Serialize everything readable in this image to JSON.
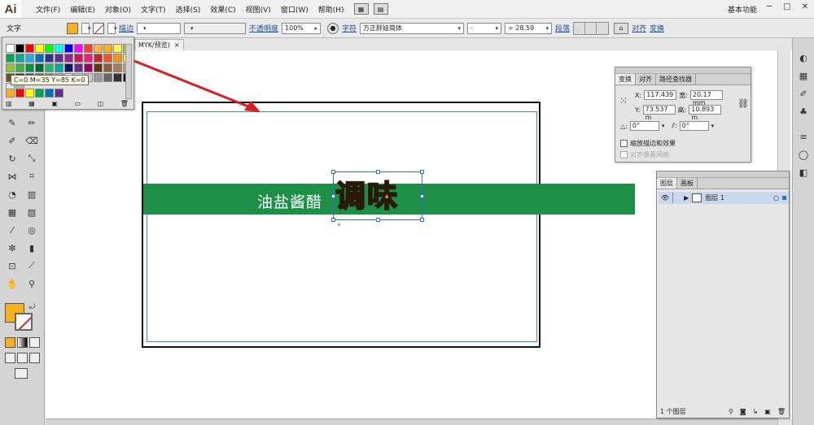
{
  "app": {
    "logo": "Ai",
    "workspace": "基本功能"
  },
  "menu": [
    "文件(F)",
    "编辑(E)",
    "对象(O)",
    "文字(T)",
    "选择(S)",
    "效果(C)",
    "视图(V)",
    "窗口(W)",
    "帮助(H)"
  ],
  "control_bar": {
    "selection_type": "文字",
    "stroke_label": "描边",
    "opacity_label": "不透明度",
    "opacity_value": "100%",
    "char_label": "字符",
    "font_name": "方正胖娃简体",
    "font_style": "-",
    "font_size": "28.59",
    "paragraph_label": "段落",
    "align_label": "对齐",
    "transform_label": "变换"
  },
  "doc_tab": {
    "label": "MYK/预览)",
    "close": "×"
  },
  "swatch_panel": {
    "tooltip": "C=0 M=35 Y=85 K=0",
    "colors": [
      "#ffffff",
      "#000000",
      "#ff0000",
      "#ffff00",
      "#00ff00",
      "#00ffff",
      "#0000ff",
      "#ff00ff",
      "#ff3b30",
      "#ffb347",
      "#f6b21c",
      "#fff44f",
      "#9acd32",
      "#00a651",
      "#00a99d",
      "#29abe2",
      "#0071bc",
      "#2e3192",
      "#662d91",
      "#93278f",
      "#d4145a",
      "#ed1e79",
      "#c1272d",
      "#f15a24",
      "#f7931e",
      "#fcee21",
      "#8cc63f",
      "#39b54a",
      "#009245",
      "#006837",
      "#22b573",
      "#00a99d",
      "#1b1464",
      "#662d91",
      "#9e005d",
      "#603813",
      "#8c6239",
      "#a67c52",
      "#c69c6d",
      "#754c24",
      "#42210b",
      "#534741",
      "#736357",
      "#998675",
      "#c7b299",
      "#ffffff",
      "#e6e6e6",
      "#cccccc",
      "#999999",
      "#666666",
      "#333333",
      "#000000",
      "#e8e8e8",
      "#b3b3b3"
    ],
    "bottom_row": [
      "#f6b21c",
      "#ff0000",
      "#ffff00",
      "#00a651",
      "#0071bc",
      "#662d91"
    ]
  },
  "canvas": {
    "band_text": "油盐酱醋",
    "title_text": "调味"
  },
  "transform_panel": {
    "tabs": [
      "变换",
      "对齐",
      "路径查找器"
    ],
    "x_label": "X:",
    "x_value": "117.439",
    "w_label": "宽:",
    "w_value": "20.17 mm",
    "y_label": "Y:",
    "y_value": "73.537 m",
    "h_label": "高:",
    "h_value": "10.893 m",
    "rot_value": "0°",
    "shear_value": "0°",
    "scale_strokes": "缩放描边和效果",
    "align_pixel": "对齐像素网格"
  },
  "layers_panel": {
    "tabs": [
      "图层",
      "画板"
    ],
    "layer_name": "图层 1",
    "count": "1 个图层"
  },
  "colors": {
    "fill": "#f6b21c",
    "band": "#1d8f46",
    "selection": "#2f6fd2",
    "arrow": "#d81e1e"
  }
}
